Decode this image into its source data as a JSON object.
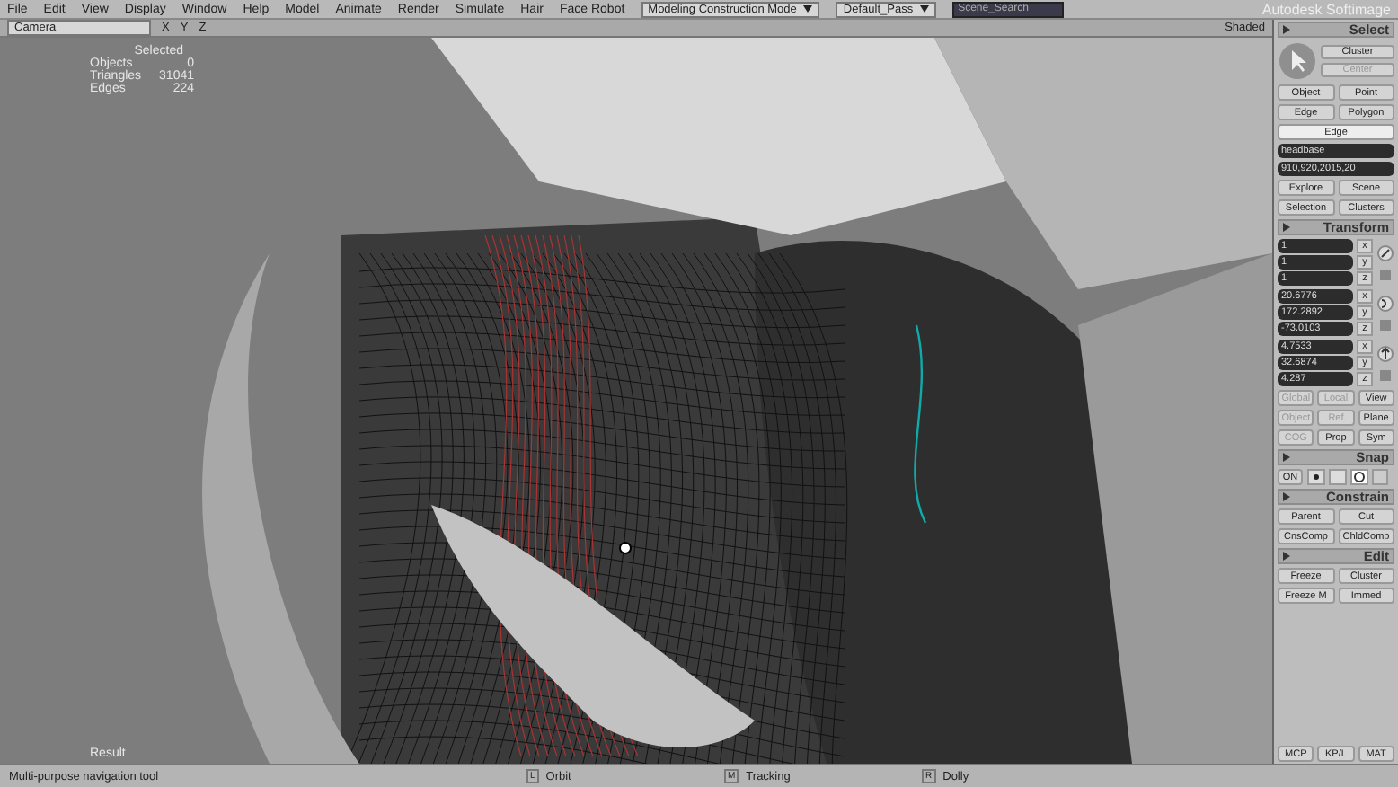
{
  "menu": [
    "File",
    "Edit",
    "View",
    "Display",
    "Window",
    "Help",
    "Model",
    "Animate",
    "Render",
    "Simulate",
    "Hair",
    "Face Robot"
  ],
  "mode_select": "Modeling Construction Mode",
  "pass_select": "Default_Pass",
  "search": {
    "placeholder": "Scene_Search"
  },
  "app_title": "Autodesk Softimage",
  "viewport": {
    "camera": "Camera",
    "axes": [
      "X",
      "Y",
      "Z"
    ],
    "display_mode": "Shaded",
    "stats_title": "Selected",
    "stats": [
      {
        "label": "Objects",
        "value": "0"
      },
      {
        "label": "Triangles",
        "value": "31041"
      },
      {
        "label": "Edges",
        "value": "224"
      }
    ],
    "axis_label": "Result"
  },
  "panel": {
    "select": {
      "title": "Select",
      "tool_buttons": [
        {
          "label": "Cluster",
          "disabled": false
        },
        {
          "label": "Center",
          "disabled": true
        }
      ],
      "type_buttons": [
        {
          "label": "Object",
          "selected": false
        },
        {
          "label": "Point",
          "selected": false
        },
        {
          "label": "Edge",
          "selected": false
        },
        {
          "label": "Polygon",
          "selected": false
        }
      ],
      "active_filter": "Edge",
      "name_field": "headbase",
      "index_field": "910,920,2015,20",
      "nav_buttons": [
        "Explore",
        "Scene",
        "Selection",
        "Clusters"
      ]
    },
    "transform": {
      "title": "Transform",
      "groups": [
        {
          "kind": "scale",
          "values": [
            {
              "axis": "x",
              "value": "1"
            },
            {
              "axis": "y",
              "value": "1"
            },
            {
              "axis": "z",
              "value": "1"
            }
          ]
        },
        {
          "kind": "rotate",
          "values": [
            {
              "axis": "x",
              "value": "20.6776"
            },
            {
              "axis": "y",
              "value": "172.2892"
            },
            {
              "axis": "z",
              "value": "-73.0103"
            }
          ]
        },
        {
          "kind": "translate",
          "values": [
            {
              "axis": "x",
              "value": "4.7533"
            },
            {
              "axis": "y",
              "value": "32.6874"
            },
            {
              "axis": "z",
              "value": "4.287"
            }
          ]
        }
      ],
      "option_rows": [
        [
          {
            "label": "Global",
            "disabled": true
          },
          {
            "label": "Local",
            "disabled": true
          },
          {
            "label": "View",
            "disabled": false
          }
        ],
        [
          {
            "label": "Object",
            "disabled": true
          },
          {
            "label": "Ref",
            "disabled": true
          },
          {
            "label": "Plane",
            "disabled": false
          }
        ],
        [
          {
            "label": "COG",
            "disabled": true
          },
          {
            "label": "Prop",
            "disabled": false
          },
          {
            "label": "Sym",
            "disabled": false
          }
        ]
      ]
    },
    "snap": {
      "title": "Snap",
      "toggle": "ON"
    },
    "constrain": {
      "title": "Constrain",
      "buttons": [
        "Parent",
        "Cut",
        "CnsComp",
        "ChldComp"
      ]
    },
    "edit": {
      "title": "Edit",
      "buttons": [
        "Freeze",
        "Cluster",
        "Freeze M",
        "Immed"
      ]
    },
    "bottom_tabs": [
      "MCP",
      "KP/L",
      "MAT"
    ]
  },
  "status": {
    "message": "Multi-purpose navigation tool",
    "mouse_hints": [
      {
        "key": "L",
        "action": "Orbit"
      },
      {
        "key": "M",
        "action": "Tracking"
      },
      {
        "key": "R",
        "action": "Dolly"
      }
    ]
  }
}
